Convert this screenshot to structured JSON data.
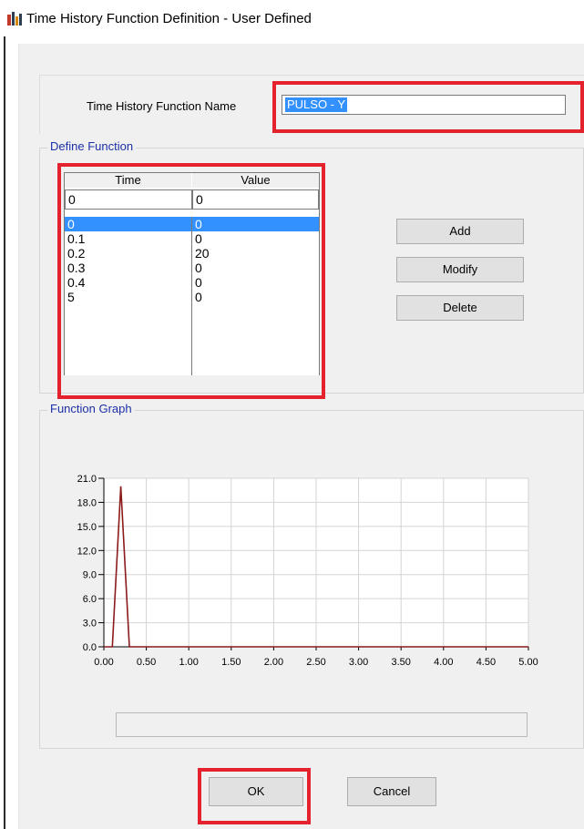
{
  "window": {
    "title": "Time History Function Definition  - User Defined",
    "icon": "app-icon"
  },
  "function_name": {
    "label": "Time History Function Name",
    "value": "PULSO - Y"
  },
  "define_function": {
    "title": "Define Function",
    "columns": [
      "Time",
      "Value"
    ],
    "edit_row": {
      "time": "0",
      "value": "0"
    },
    "rows": [
      {
        "time": "0",
        "value": "0",
        "selected": true
      },
      {
        "time": "0.1",
        "value": "0"
      },
      {
        "time": "0.2",
        "value": "20"
      },
      {
        "time": "0.3",
        "value": "0"
      },
      {
        "time": "0.4",
        "value": "0"
      },
      {
        "time": "5",
        "value": "0"
      }
    ]
  },
  "buttons": {
    "add": "Add",
    "modify": "Modify",
    "delete": "Delete",
    "ok": "OK",
    "cancel": "Cancel"
  },
  "graph": {
    "title": "Function Graph"
  },
  "chart_data": {
    "type": "line",
    "x": [
      0,
      0.1,
      0.2,
      0.3,
      0.4,
      5
    ],
    "series": [
      {
        "values": [
          0,
          0,
          20,
          0,
          0,
          0
        ]
      }
    ],
    "xlim": [
      0,
      5
    ],
    "ylim": [
      0,
      21
    ],
    "xticks": [
      "0.00",
      "0.50",
      "1.00",
      "1.50",
      "2.00",
      "2.50",
      "3.00",
      "3.50",
      "4.00",
      "4.50",
      "5.00"
    ],
    "yticks": [
      "0.0",
      "3.0",
      "6.0",
      "9.0",
      "12.0",
      "15.0",
      "18.0",
      "21.0"
    ],
    "grid": true,
    "line_color": "#8b1a1a"
  },
  "colors": {
    "highlight": "#e3222e",
    "selection": "#3390ff",
    "group_title": "#1c2fa8"
  }
}
